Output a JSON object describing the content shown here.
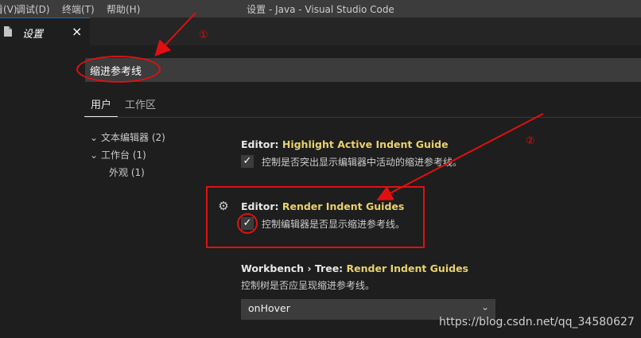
{
  "menubar": {
    "items": [
      "查看(V)",
      "调试(D)",
      "终端(T)",
      "帮助(H)"
    ],
    "window_title": "设置 - Java - Visual Studio Code"
  },
  "tab": {
    "label": "设置",
    "close": "×"
  },
  "search": {
    "value": "缩进参考线"
  },
  "scopes": {
    "user": "用户",
    "workspace": "工作区"
  },
  "toc": [
    {
      "label": "文本编辑器 (2)",
      "expanded": true
    },
    {
      "label": "工作台 (1)",
      "expanded": true
    },
    {
      "label": "外观 (1)",
      "expanded": false
    }
  ],
  "settings": [
    {
      "category": "Editor: ",
      "key": "Highlight Active Indent Guide",
      "description": "控制是否突出显示编辑器中活动的缩进参考线。",
      "checked": true
    },
    {
      "category": "Editor: ",
      "key": "Render Indent Guides",
      "description": "控制编辑器是否显示缩进参考线。",
      "checked": true
    },
    {
      "category": "Workbench › Tree: ",
      "key": "Render Indent Guides",
      "description": "控制树是否应呈现缩进参考线。",
      "select_value": "onHover"
    }
  ],
  "annotations": {
    "marker_1": "①",
    "marker_2": "②",
    "color": "#e01010"
  },
  "watermark": "https://blog.csdn.net/qq_34580627",
  "colors": {
    "accent_key": "#e9d16c",
    "background": "#1e1e1e"
  }
}
